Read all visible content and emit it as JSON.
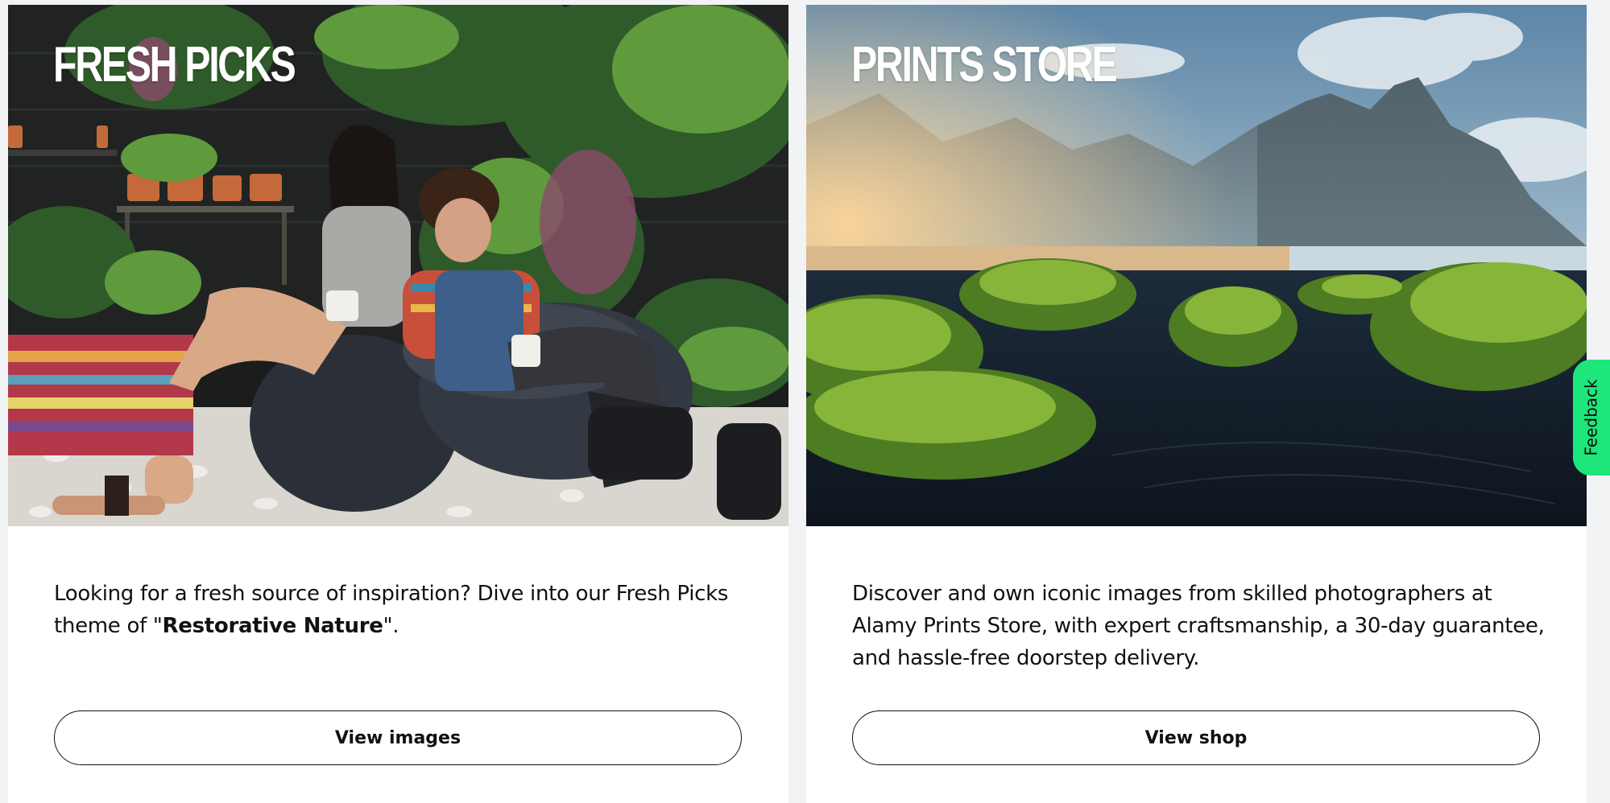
{
  "cards": [
    {
      "title": "FRESH PICKS",
      "text_before": "Looking for a fresh source of inspiration? Dive into our Fresh Picks theme of \"",
      "text_bold": "Restorative Nature",
      "text_after": "\".",
      "button_label": "View images"
    },
    {
      "title": "PRINTS STORE",
      "text": "Discover and own iconic images from skilled photographers at Alamy Prints Store, with expert craftsmanship, a 30-day guarantee, and hassle-free doorstep delivery.",
      "button_label": "View shop"
    }
  ],
  "feedback": {
    "label": "Feedback",
    "color": "#1de67b"
  }
}
